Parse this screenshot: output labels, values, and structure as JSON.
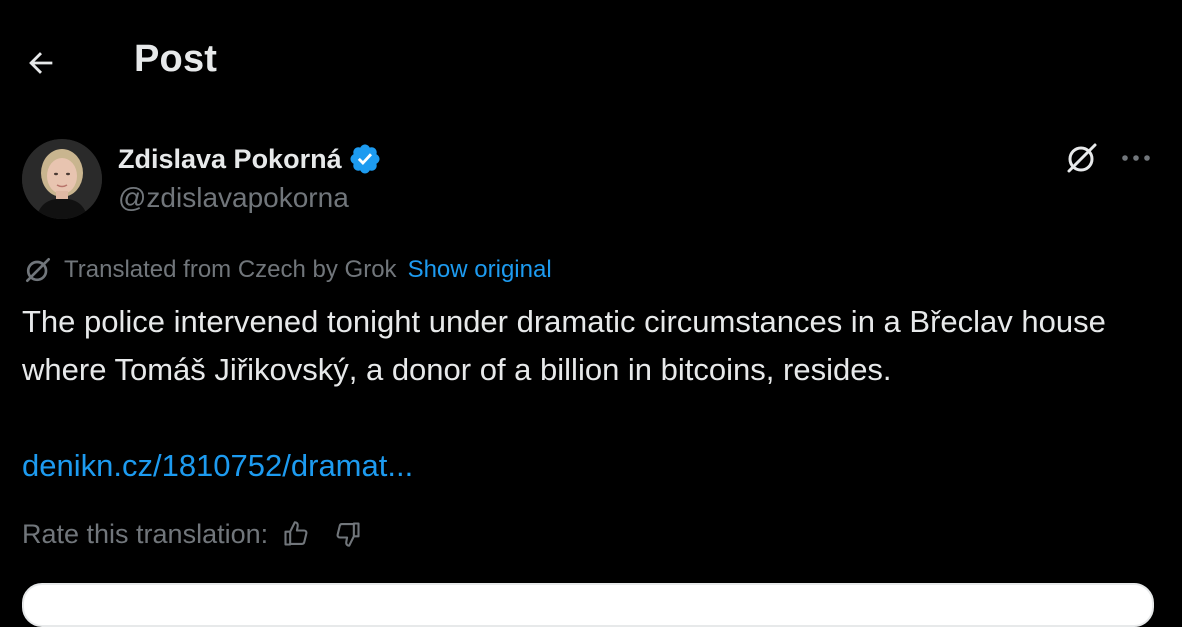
{
  "header": {
    "back_icon": "arrow-left-icon",
    "title": "Post"
  },
  "author": {
    "name": "Zdislava Pokorná",
    "handle": "@zdislavapokorna",
    "verified_icon": "verified-badge-icon",
    "verified_color": "#1d9bf0",
    "avatar_icon": "avatar-photo"
  },
  "actions": {
    "grok_icon": "grok-icon",
    "more_icon": "more-horizontal-icon"
  },
  "translation": {
    "label": "Translated from Czech by Grok",
    "show_original": "Show original",
    "rate_label": "Rate this translation:",
    "thumbs_up_icon": "thumbs-up-icon",
    "thumbs_down_icon": "thumbs-down-icon"
  },
  "post": {
    "text": "The police intervened tonight under dramatic circumstances in a Břeclav house where Tomáš Jiřikovský, a donor of a billion in bitcoins, resides.",
    "link": "denikn.cz/1810752/dramat..."
  },
  "colors": {
    "background": "#000000",
    "text": "#e7e9ea",
    "secondary_text": "#71767b",
    "link": "#1d9bf0"
  }
}
